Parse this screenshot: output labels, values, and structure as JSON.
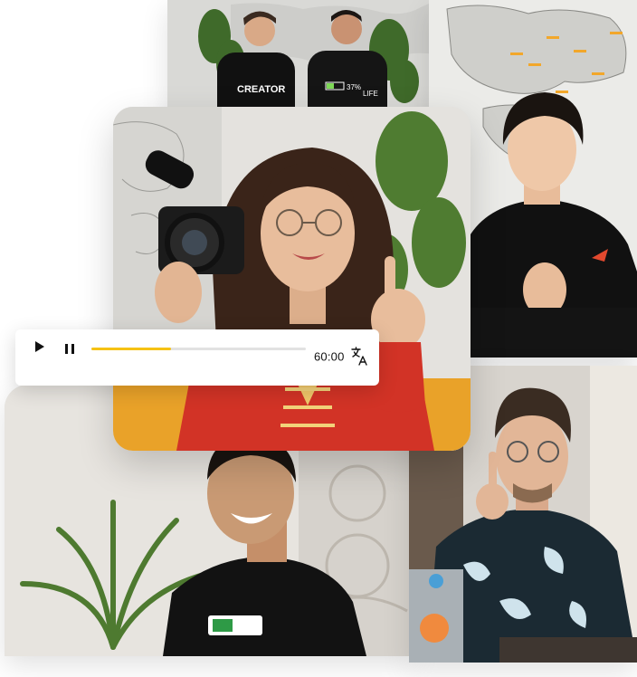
{
  "cards": [
    {
      "id": "hosts",
      "shirt_text_left": "CREATOR",
      "shirt_text_right": "LIFE",
      "shirt_battery": "37%"
    },
    {
      "id": "map-presenter"
    },
    {
      "id": "camera-presenter"
    },
    {
      "id": "laughing-presenter"
    },
    {
      "id": "glasses-presenter"
    }
  ],
  "player": {
    "time": "60:00",
    "progress": 0.37,
    "accent_color": "#f6c214",
    "icons": [
      "play-icon",
      "pause-icon",
      "translate-icon"
    ]
  }
}
